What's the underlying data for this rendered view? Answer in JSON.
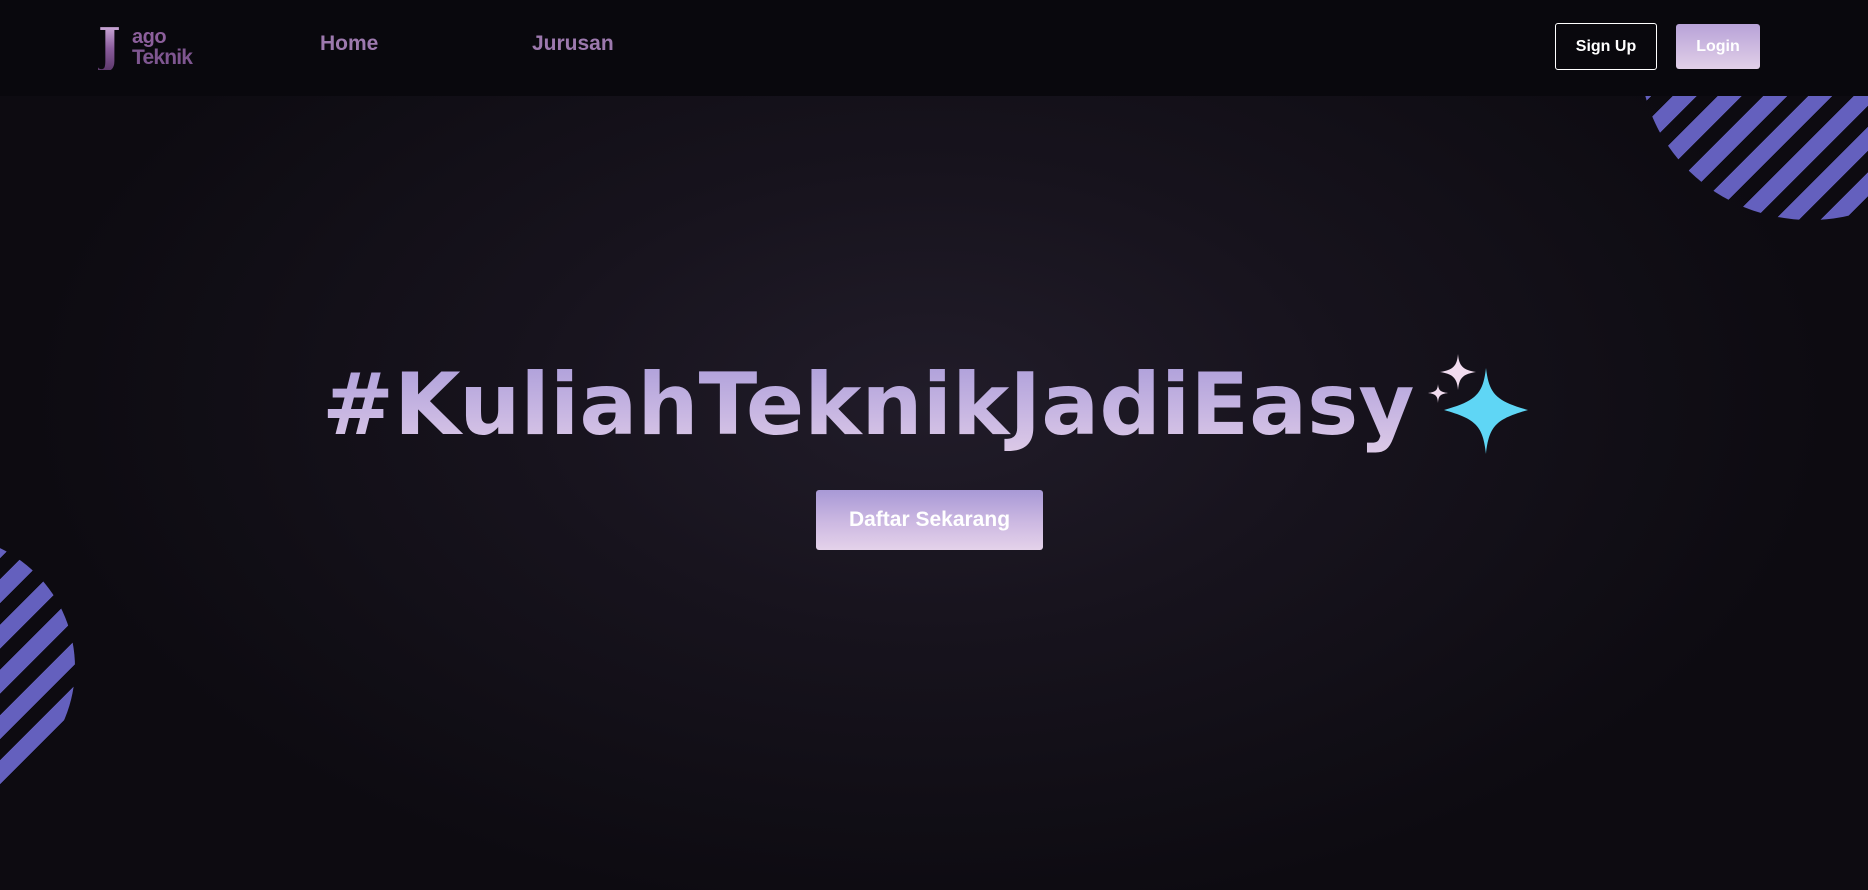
{
  "navbar": {
    "logo": {
      "letter": "J",
      "top_text": "ago",
      "bottom_text": "Teknik"
    },
    "links": {
      "home": "Home",
      "jurusan": "Jurusan"
    },
    "buttons": {
      "signup": "Sign Up",
      "login": "Login"
    }
  },
  "hero": {
    "title": "#KuliahTeknikJadiEasy",
    "cta": "Daftar Sekarang",
    "sparkles_icon": "sparkles-icon"
  },
  "colors": {
    "background": "#0b0a10",
    "navbar": "#09080d",
    "accent_purple": "#b8a2d8",
    "nav_link": "#9d79ae",
    "stripe_blue": "#6460be",
    "sparkle_cyan": "#5fd6f5",
    "sparkle_pink": "#f1dcef"
  }
}
